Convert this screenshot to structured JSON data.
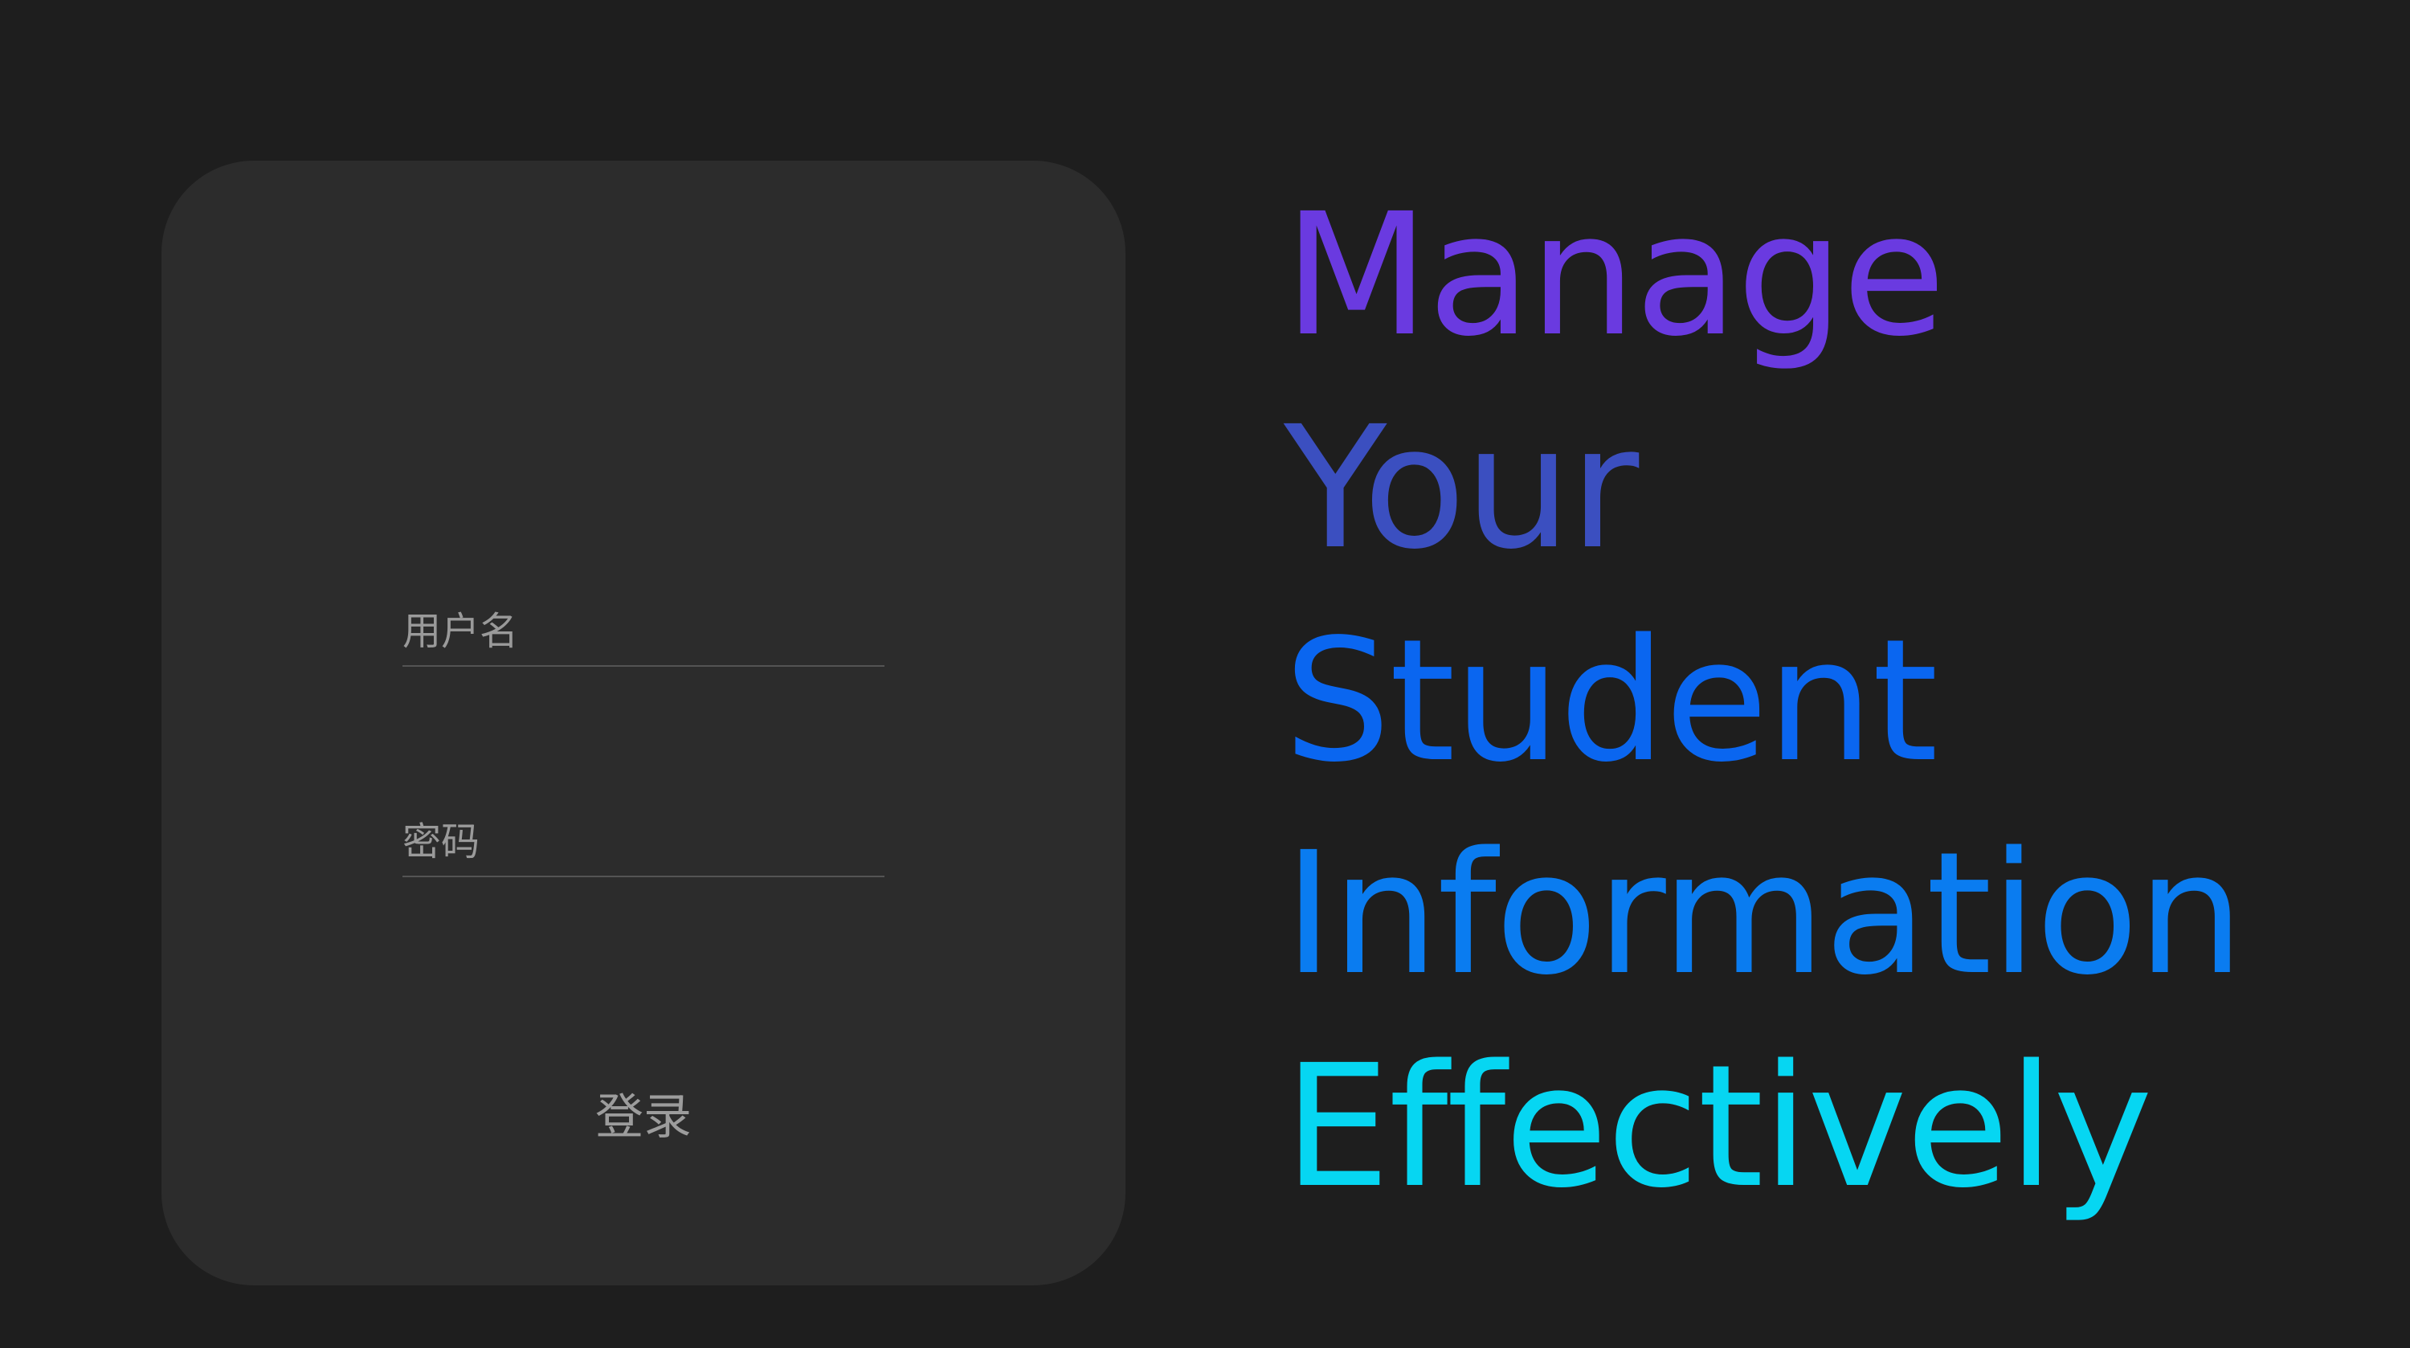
{
  "login_form": {
    "username_placeholder": "用户名",
    "password_placeholder": "密码",
    "submit_label": "登录"
  },
  "headline": {
    "lines": [
      {
        "text": "Manage",
        "color": "#6a3ae0"
      },
      {
        "text": "Your",
        "color": "#3b4fc0"
      },
      {
        "text": "Student",
        "color": "#0a66f0"
      },
      {
        "text": "Information",
        "color": "#0a7cf0"
      },
      {
        "text": "Effectively",
        "color": "#06d6f2"
      }
    ]
  },
  "colors": {
    "background": "#1e1e1e",
    "card": "#2c2c2c"
  }
}
